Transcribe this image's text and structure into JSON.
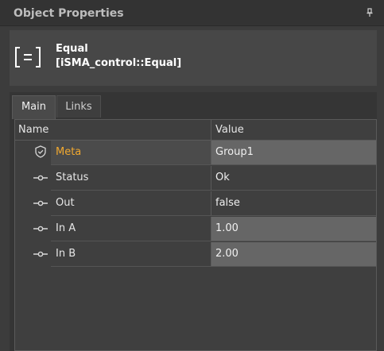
{
  "panel": {
    "title": "Object Properties"
  },
  "object": {
    "name": "Equal",
    "type": "[iSMA_control::Equal]"
  },
  "tabs": [
    {
      "label": "Main",
      "active": true
    },
    {
      "label": "Links",
      "active": false
    }
  ],
  "grid": {
    "columns": {
      "name": "Name",
      "value": "Value"
    },
    "rows": [
      {
        "name": "Meta",
        "value": "Group1",
        "icon": "shield-icon",
        "editable": true
      },
      {
        "name": "Status",
        "value": "Ok",
        "icon": "slot-connector-icon",
        "editable": false
      },
      {
        "name": "Out",
        "value": "false",
        "icon": "slot-connector-icon",
        "editable": false
      },
      {
        "name": "In A",
        "value": "1.00",
        "icon": "slot-connector-icon",
        "editable": true
      },
      {
        "name": "In B",
        "value": "2.00",
        "icon": "slot-connector-icon",
        "editable": true
      }
    ]
  },
  "colors": {
    "meta_label": "#f0a830",
    "editable_value_bg": "#666666"
  }
}
